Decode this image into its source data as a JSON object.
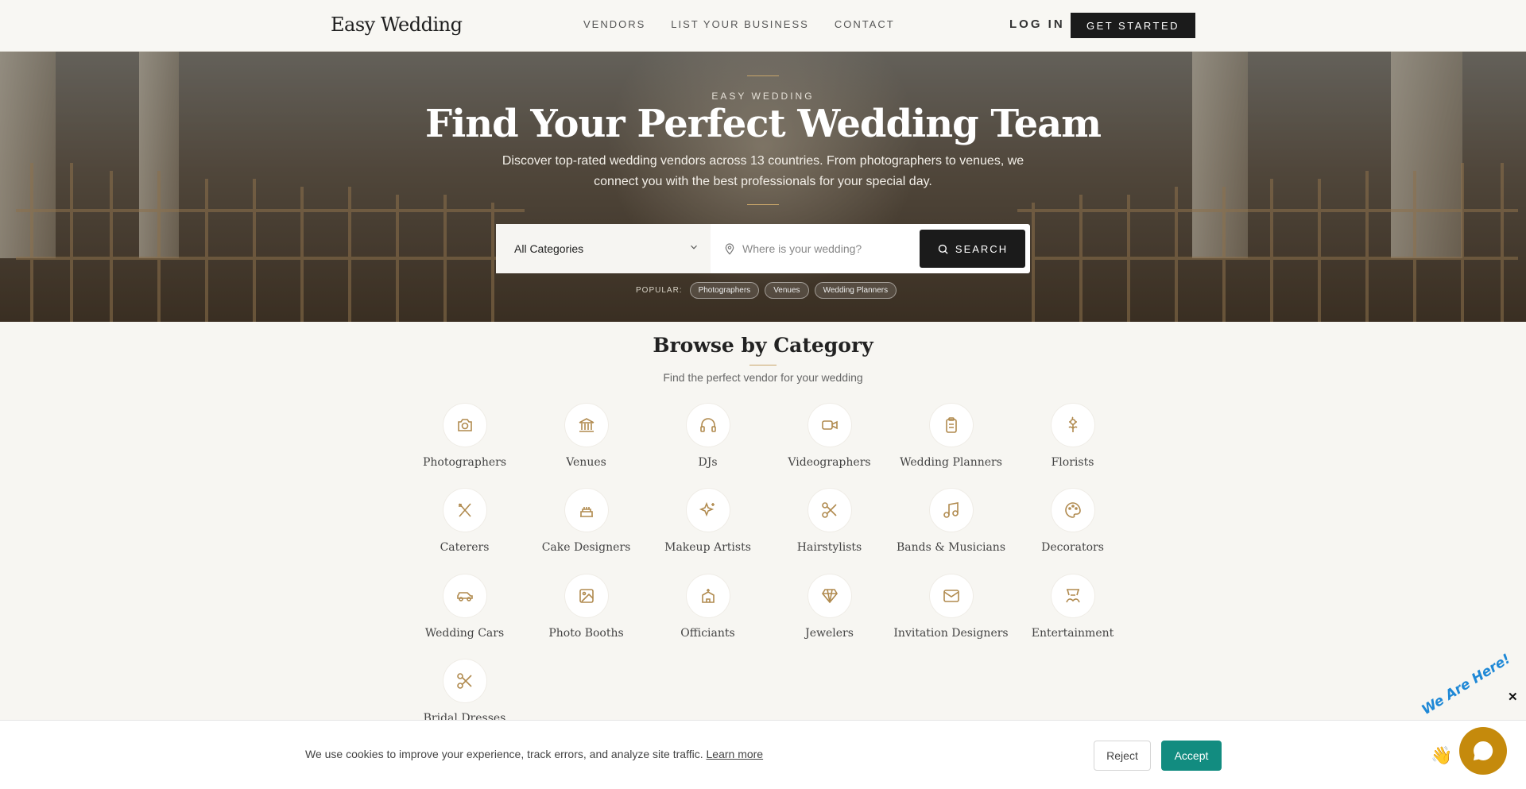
{
  "header": {
    "logo": "Easy Wedding",
    "nav": [
      "VENDORS",
      "LIST YOUR BUSINESS",
      "CONTACT"
    ],
    "login": "LOG IN",
    "cta": "GET STARTED"
  },
  "hero": {
    "eyebrow": "EASY WEDDING",
    "title": "Find Your Perfect Wedding Team",
    "subtitle": "Discover top-rated wedding vendors across 13 countries. From photographers to venues, we connect you with the best professionals for your special day.",
    "search": {
      "category": "All Categories",
      "location_placeholder": "Where is your wedding?",
      "button": "SEARCH"
    },
    "popular_label": "POPULAR:",
    "popular": [
      "Photographers",
      "Venues",
      "Wedding Planners"
    ]
  },
  "browse": {
    "title": "Browse by Category",
    "subtitle": "Find the perfect vendor for your wedding",
    "categories": [
      {
        "name": "Photographers",
        "icon": "camera-icon"
      },
      {
        "name": "Venues",
        "icon": "landmark-icon"
      },
      {
        "name": "DJs",
        "icon": "headphones-icon"
      },
      {
        "name": "Videographers",
        "icon": "video-icon"
      },
      {
        "name": "Wedding Planners",
        "icon": "clipboard-icon"
      },
      {
        "name": "Florists",
        "icon": "flower-icon"
      },
      {
        "name": "Caterers",
        "icon": "utensils-icon"
      },
      {
        "name": "Cake Designers",
        "icon": "cake-icon"
      },
      {
        "name": "Makeup Artists",
        "icon": "sparkles-icon"
      },
      {
        "name": "Hairstylists",
        "icon": "scissors-icon"
      },
      {
        "name": "Bands & Musicians",
        "icon": "music-icon"
      },
      {
        "name": "Decorators",
        "icon": "palette-icon"
      },
      {
        "name": "Wedding Cars",
        "icon": "car-icon"
      },
      {
        "name": "Photo Booths",
        "icon": "image-icon"
      },
      {
        "name": "Officiants",
        "icon": "church-icon"
      },
      {
        "name": "Jewelers",
        "icon": "gem-icon"
      },
      {
        "name": "Invitation Designers",
        "icon": "mail-icon"
      },
      {
        "name": "Entertainment",
        "icon": "drama-icon"
      },
      {
        "name": "Bridal Dresses",
        "icon": "scissors-icon"
      }
    ]
  },
  "cookie": {
    "text": "We use cookies to improve your experience, track errors, and analyze site traffic.",
    "link": "Learn more",
    "reject": "Reject",
    "accept": "Accept"
  },
  "chat": {
    "tagline": "We Are Here!",
    "close": "✕"
  },
  "colors": {
    "accent_gold": "#c8a56a",
    "dark": "#1b1b1b",
    "accept_teal": "#128c80",
    "chat_amber": "#c58a0c"
  }
}
